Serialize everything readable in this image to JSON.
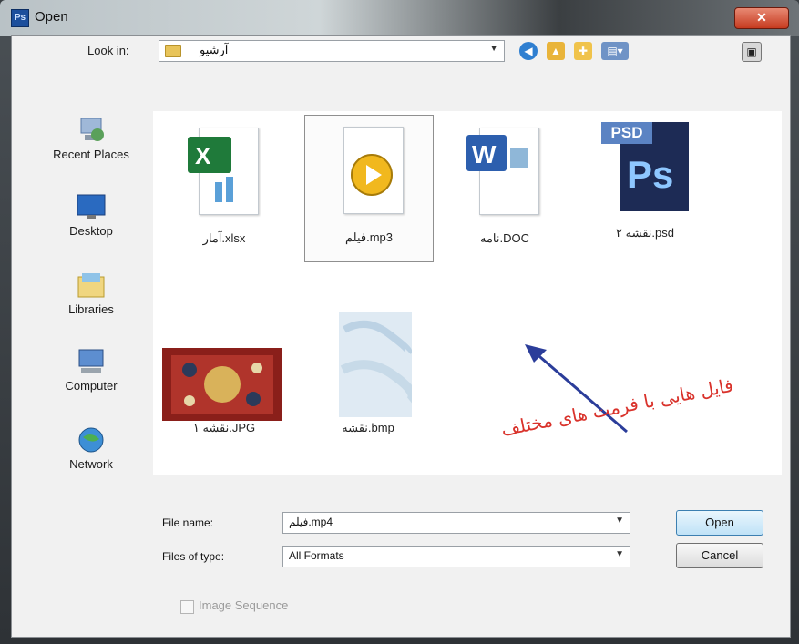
{
  "window": {
    "title": "Open",
    "app_icon": "Ps",
    "close_glyph": "✕"
  },
  "lookin": {
    "label": "Look in:",
    "value": "آرشیو"
  },
  "places": [
    {
      "label": "Recent Places",
      "icon": "recent-places-icon"
    },
    {
      "label": "Desktop",
      "icon": "desktop-icon"
    },
    {
      "label": "Libraries",
      "icon": "libraries-icon"
    },
    {
      "label": "Computer",
      "icon": "computer-icon"
    },
    {
      "label": "Network",
      "icon": "network-icon"
    }
  ],
  "files": [
    {
      "name": "آمار.xlsx",
      "icon": "excel-file-icon"
    },
    {
      "name": "فیلم.mp3",
      "icon": "media-file-icon"
    },
    {
      "name": "نامه.DOC",
      "icon": "word-file-icon"
    },
    {
      "name": "نقشه ۲.psd",
      "icon": "photoshop-file-icon",
      "badge": "PSD",
      "mark": "Ps"
    },
    {
      "name": "نقشه ۱.JPG",
      "icon": "jpg-file-icon"
    },
    {
      "name": "نقشه.bmp",
      "icon": "bmp-file-icon"
    }
  ],
  "annotation": "فایل هایی با فرمت های مختلف",
  "filename": {
    "label": "File name:",
    "value": "فیلم.mp4"
  },
  "filetype": {
    "label": "Files of type:",
    "value": "All Formats"
  },
  "buttons": {
    "open": "Open",
    "cancel": "Cancel"
  },
  "image_sequence": "Image Sequence",
  "colors": {
    "annotation_text": "#d9322b",
    "arrow": "#2b3d9a"
  }
}
